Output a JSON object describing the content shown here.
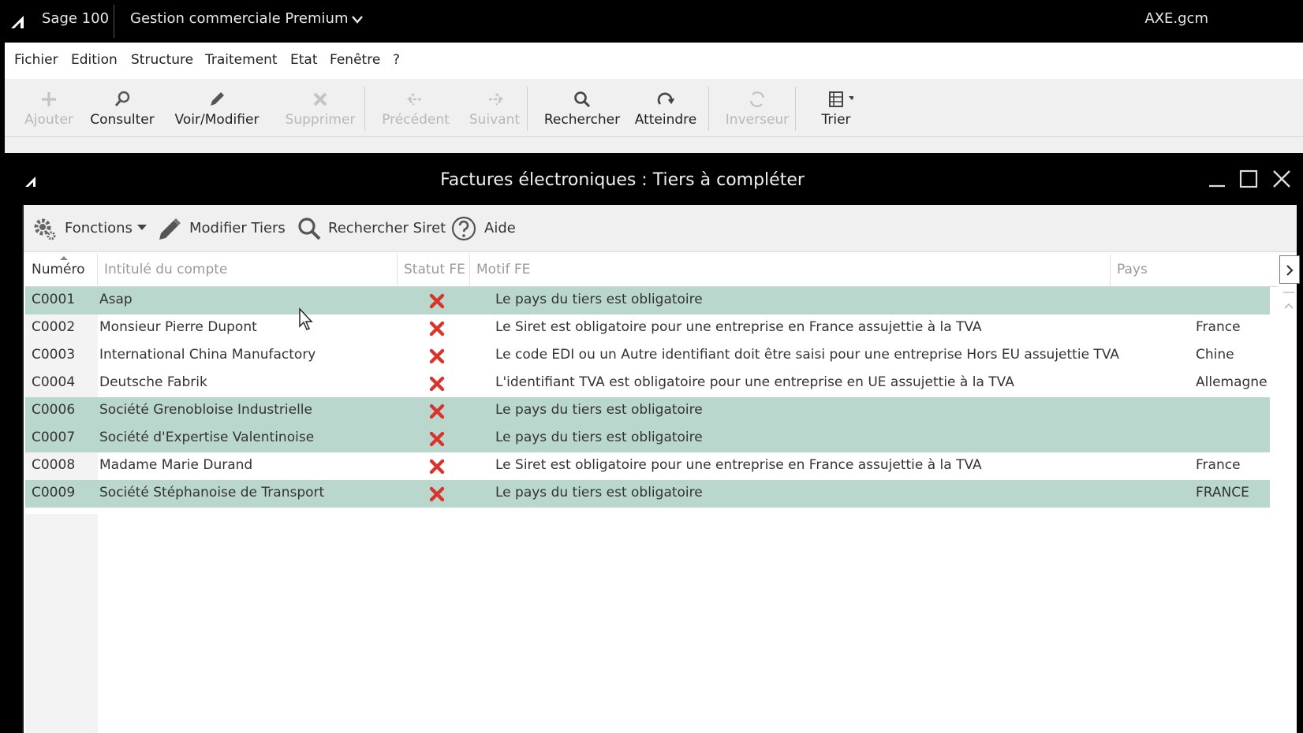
{
  "titlebar": {
    "app_name": "Sage 100",
    "product": "Gestion commerciale Premium",
    "file": "AXE.gcm"
  },
  "menu": [
    "Fichier",
    "Edition",
    "Structure",
    "Traitement",
    "Etat",
    "Fenêtre",
    "?"
  ],
  "toolbar": {
    "add": "Ajouter",
    "view": "Consulter",
    "edit": "Voir/Modifier",
    "delete": "Supprimer",
    "prev": "Précédent",
    "next": "Suivant",
    "search": "Rechercher",
    "goto": "Atteindre",
    "invert": "Inverseur",
    "sort": "Trier"
  },
  "window": {
    "title": "Factures électroniques : Tiers à compléter"
  },
  "actions": {
    "functions": "Fonctions",
    "edit_tiers": "Modifier Tiers",
    "search_siret": "Rechercher Siret",
    "help": "Aide"
  },
  "columns": {
    "number": "Numéro",
    "account": "Intitulé du compte",
    "status": "Statut FE",
    "motif": "Motif FE",
    "country": "Pays"
  },
  "rows": [
    {
      "num": "C0001",
      "name": "Asap",
      "motif": "Le pays du tiers est obligatoire",
      "pays": "",
      "highlight": true
    },
    {
      "num": "C0002",
      "name": "Monsieur Pierre Dupont",
      "motif": "Le Siret est obligatoire pour une entreprise en France assujettie à la TVA",
      "pays": "France",
      "highlight": false
    },
    {
      "num": "C0003",
      "name": "International China Manufactory",
      "motif": "Le code EDI ou un Autre identifiant doit être saisi pour une entreprise Hors EU assujettie TVA",
      "pays": "Chine",
      "highlight": false
    },
    {
      "num": "C0004",
      "name": "Deutsche Fabrik",
      "motif": "L'identifiant TVA est obligatoire pour une entreprise en UE assujettie à la TVA",
      "pays": "Allemagne",
      "highlight": false
    },
    {
      "num": "C0006",
      "name": "Société Grenobloise Industrielle",
      "motif": "Le pays du tiers est obligatoire",
      "pays": "",
      "highlight": true
    },
    {
      "num": "C0007",
      "name": "Société d'Expertise Valentinoise",
      "motif": "Le pays du tiers est obligatoire",
      "pays": "",
      "highlight": true
    },
    {
      "num": "C0008",
      "name": "Madame Marie Durand",
      "motif": "Le Siret est obligatoire pour une entreprise en France assujettie à la TVA",
      "pays": "France",
      "highlight": false
    },
    {
      "num": "C0009",
      "name": "Société Stéphanoise de Transport",
      "motif": "Le pays du tiers est obligatoire",
      "pays": "FRANCE",
      "highlight": true
    }
  ],
  "colors": {
    "highlight_row": "#b9d7cd",
    "status_error": "#d9342b"
  }
}
